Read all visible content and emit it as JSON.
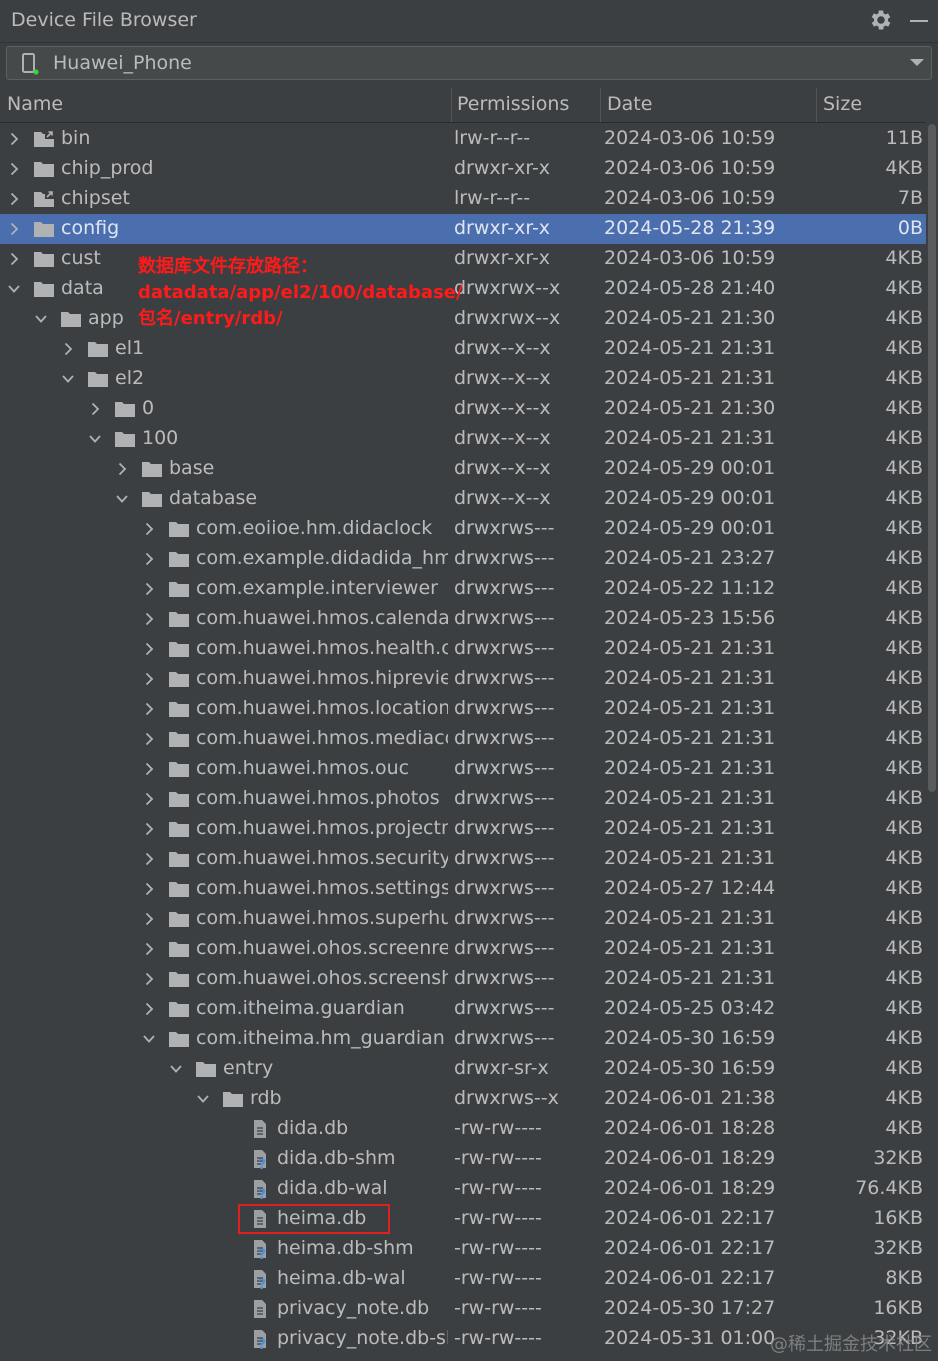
{
  "window": {
    "title": "Device File Browser",
    "device": "Huawei_Phone"
  },
  "columns": {
    "name": "Name",
    "permissions": "Permissions",
    "date": "Date",
    "size": "Size"
  },
  "annotation": {
    "line1": "数据库文件存放路径：",
    "line2": "datadata/app/el2/100/database/",
    "line3": "包名/entry/rdb/"
  },
  "watermark": "@稀土掘金技术社区",
  "colors": {
    "selected_row": "#4b6eaf",
    "annotation": "#ff1a1a",
    "highlight_box": "#e02020",
    "device_online_dot": "#3fcf3f"
  },
  "rows": [
    {
      "name": "bin",
      "perm": "lrw-r--r--",
      "date": "2024-03-06 10:59",
      "size": "11B",
      "depth": 0,
      "arrow": "collapsed",
      "icon": "folder-link-icon",
      "selected": false
    },
    {
      "name": "chip_prod",
      "perm": "drwxr-xr-x",
      "date": "2024-03-06 10:59",
      "size": "4KB",
      "depth": 0,
      "arrow": "collapsed",
      "icon": "folder-icon",
      "selected": false
    },
    {
      "name": "chipset",
      "perm": "lrw-r--r--",
      "date": "2024-03-06 10:59",
      "size": "7B",
      "depth": 0,
      "arrow": "collapsed",
      "icon": "folder-link-icon",
      "selected": false
    },
    {
      "name": "config",
      "perm": "drwxr-xr-x",
      "date": "2024-05-28 21:39",
      "size": "0B",
      "depth": 0,
      "arrow": "collapsed",
      "icon": "folder-icon",
      "selected": true
    },
    {
      "name": "cust",
      "perm": "drwxr-xr-x",
      "date": "2024-03-06 10:59",
      "size": "4KB",
      "depth": 0,
      "arrow": "collapsed",
      "icon": "folder-icon",
      "selected": false
    },
    {
      "name": "data",
      "perm": "drwxrwx--x",
      "date": "2024-05-28 21:40",
      "size": "4KB",
      "depth": 0,
      "arrow": "expanded",
      "icon": "folder-icon",
      "selected": false
    },
    {
      "name": "app",
      "perm": "drwxrwx--x",
      "date": "2024-05-21 21:30",
      "size": "4KB",
      "depth": 1,
      "arrow": "expanded",
      "icon": "folder-icon",
      "selected": false
    },
    {
      "name": "el1",
      "perm": "drwx--x--x",
      "date": "2024-05-21 21:31",
      "size": "4KB",
      "depth": 2,
      "arrow": "collapsed",
      "icon": "folder-icon",
      "selected": false
    },
    {
      "name": "el2",
      "perm": "drwx--x--x",
      "date": "2024-05-21 21:31",
      "size": "4KB",
      "depth": 2,
      "arrow": "expanded",
      "icon": "folder-icon",
      "selected": false
    },
    {
      "name": "0",
      "perm": "drwx--x--x",
      "date": "2024-05-21 21:30",
      "size": "4KB",
      "depth": 3,
      "arrow": "collapsed",
      "icon": "folder-icon",
      "selected": false
    },
    {
      "name": "100",
      "perm": "drwx--x--x",
      "date": "2024-05-21 21:31",
      "size": "4KB",
      "depth": 3,
      "arrow": "expanded",
      "icon": "folder-icon",
      "selected": false
    },
    {
      "name": "base",
      "perm": "drwx--x--x",
      "date": "2024-05-29 00:01",
      "size": "4KB",
      "depth": 4,
      "arrow": "collapsed",
      "icon": "folder-icon",
      "selected": false
    },
    {
      "name": "database",
      "perm": "drwx--x--x",
      "date": "2024-05-29 00:01",
      "size": "4KB",
      "depth": 4,
      "arrow": "expanded",
      "icon": "folder-icon",
      "selected": false
    },
    {
      "name": "com.eoiioe.hm.didaclock",
      "perm": "drwxrws---",
      "date": "2024-05-29 00:01",
      "size": "4KB",
      "depth": 5,
      "arrow": "collapsed",
      "icon": "folder-icon",
      "selected": false
    },
    {
      "name": "com.example.didadida_hmos",
      "perm": "drwxrws---",
      "date": "2024-05-21 23:27",
      "size": "4KB",
      "depth": 5,
      "arrow": "collapsed",
      "icon": "folder-icon",
      "selected": false
    },
    {
      "name": "com.example.interviewer",
      "perm": "drwxrws---",
      "date": "2024-05-22 11:12",
      "size": "4KB",
      "depth": 5,
      "arrow": "collapsed",
      "icon": "folder-icon",
      "selected": false
    },
    {
      "name": "com.huawei.hmos.calendardata",
      "perm": "drwxrws---",
      "date": "2024-05-23 15:56",
      "size": "4KB",
      "depth": 5,
      "arrow": "collapsed",
      "icon": "folder-icon",
      "selected": false
    },
    {
      "name": "com.huawei.hmos.health.core",
      "perm": "drwxrws---",
      "date": "2024-05-21 21:31",
      "size": "4KB",
      "depth": 5,
      "arrow": "collapsed",
      "icon": "folder-icon",
      "selected": false
    },
    {
      "name": "com.huawei.hmos.hipreview",
      "perm": "drwxrws---",
      "date": "2024-05-21 21:31",
      "size": "4KB",
      "depth": 5,
      "arrow": "collapsed",
      "icon": "folder-icon",
      "selected": false
    },
    {
      "name": "com.huawei.hmos.location",
      "perm": "drwxrws---",
      "date": "2024-05-21 21:31",
      "size": "4KB",
      "depth": 5,
      "arrow": "collapsed",
      "icon": "folder-icon",
      "selected": false
    },
    {
      "name": "com.huawei.hmos.mediacontroller",
      "perm": "drwxrws---",
      "date": "2024-05-21 21:31",
      "size": "4KB",
      "depth": 5,
      "arrow": "collapsed",
      "icon": "folder-icon",
      "selected": false
    },
    {
      "name": "com.huawei.hmos.ouc",
      "perm": "drwxrws---",
      "date": "2024-05-21 21:31",
      "size": "4KB",
      "depth": 5,
      "arrow": "collapsed",
      "icon": "folder-icon",
      "selected": false
    },
    {
      "name": "com.huawei.hmos.photos",
      "perm": "drwxrws---",
      "date": "2024-05-21 21:31",
      "size": "4KB",
      "depth": 5,
      "arrow": "collapsed",
      "icon": "folder-icon",
      "selected": false
    },
    {
      "name": "com.huawei.hmos.projectmenu",
      "perm": "drwxrws---",
      "date": "2024-05-21 21:31",
      "size": "4KB",
      "depth": 5,
      "arrow": "collapsed",
      "icon": "folder-icon",
      "selected": false
    },
    {
      "name": "com.huawei.hmos.security.privacy",
      "perm": "drwxrws---",
      "date": "2024-05-21 21:31",
      "size": "4KB",
      "depth": 5,
      "arrow": "collapsed",
      "icon": "folder-icon",
      "selected": false
    },
    {
      "name": "com.huawei.hmos.settings",
      "perm": "drwxrws---",
      "date": "2024-05-27 12:44",
      "size": "4KB",
      "depth": 5,
      "arrow": "collapsed",
      "icon": "folder-icon",
      "selected": false
    },
    {
      "name": "com.huawei.hmos.superhub",
      "perm": "drwxrws---",
      "date": "2024-05-21 21:31",
      "size": "4KB",
      "depth": 5,
      "arrow": "collapsed",
      "icon": "folder-icon",
      "selected": false
    },
    {
      "name": "com.huawei.ohos.screenrecorder",
      "perm": "drwxrws---",
      "date": "2024-05-21 21:31",
      "size": "4KB",
      "depth": 5,
      "arrow": "collapsed",
      "icon": "folder-icon",
      "selected": false
    },
    {
      "name": "com.huawei.ohos.screenshot",
      "perm": "drwxrws---",
      "date": "2024-05-21 21:31",
      "size": "4KB",
      "depth": 5,
      "arrow": "collapsed",
      "icon": "folder-icon",
      "selected": false
    },
    {
      "name": "com.itheima.guardian",
      "perm": "drwxrws---",
      "date": "2024-05-25 03:42",
      "size": "4KB",
      "depth": 5,
      "arrow": "collapsed",
      "icon": "folder-icon",
      "selected": false
    },
    {
      "name": "com.itheima.hm_guardian",
      "perm": "drwxrws---",
      "date": "2024-05-30 16:59",
      "size": "4KB",
      "depth": 5,
      "arrow": "expanded",
      "icon": "folder-icon",
      "selected": false
    },
    {
      "name": "entry",
      "perm": "drwxr-sr-x",
      "date": "2024-05-30 16:59",
      "size": "4KB",
      "depth": 6,
      "arrow": "expanded",
      "icon": "folder-icon",
      "selected": false
    },
    {
      "name": "rdb",
      "perm": "drwxrws--x",
      "date": "2024-06-01 21:38",
      "size": "4KB",
      "depth": 7,
      "arrow": "expanded",
      "icon": "folder-icon",
      "selected": false
    },
    {
      "name": "dida.db",
      "perm": "-rw-rw----",
      "date": "2024-06-01 18:28",
      "size": "4KB",
      "depth": 8,
      "arrow": "none",
      "icon": "file-icon",
      "selected": false
    },
    {
      "name": "dida.db-shm",
      "perm": "-rw-rw----",
      "date": "2024-06-01 18:29",
      "size": "32KB",
      "depth": 8,
      "arrow": "none",
      "icon": "unknown-file-icon",
      "selected": false
    },
    {
      "name": "dida.db-wal",
      "perm": "-rw-rw----",
      "date": "2024-06-01 18:29",
      "size": "76.4KB",
      "depth": 8,
      "arrow": "none",
      "icon": "unknown-file-icon",
      "selected": false
    },
    {
      "name": "heima.db",
      "perm": "-rw-rw----",
      "date": "2024-06-01 22:17",
      "size": "16KB",
      "depth": 8,
      "arrow": "none",
      "icon": "file-icon",
      "selected": false
    },
    {
      "name": "heima.db-shm",
      "perm": "-rw-rw----",
      "date": "2024-06-01 22:17",
      "size": "32KB",
      "depth": 8,
      "arrow": "none",
      "icon": "unknown-file-icon",
      "selected": false
    },
    {
      "name": "heima.db-wal",
      "perm": "-rw-rw----",
      "date": "2024-06-01 22:17",
      "size": "8KB",
      "depth": 8,
      "arrow": "none",
      "icon": "unknown-file-icon",
      "selected": false
    },
    {
      "name": "privacy_note.db",
      "perm": "-rw-rw----",
      "date": "2024-05-30 17:27",
      "size": "16KB",
      "depth": 8,
      "arrow": "none",
      "icon": "file-icon",
      "selected": false
    },
    {
      "name": "privacy_note.db-shm",
      "perm": "-rw-rw----",
      "date": "2024-05-31 01:00",
      "size": "32KB",
      "depth": 8,
      "arrow": "none",
      "icon": "unknown-file-icon",
      "selected": false
    }
  ]
}
